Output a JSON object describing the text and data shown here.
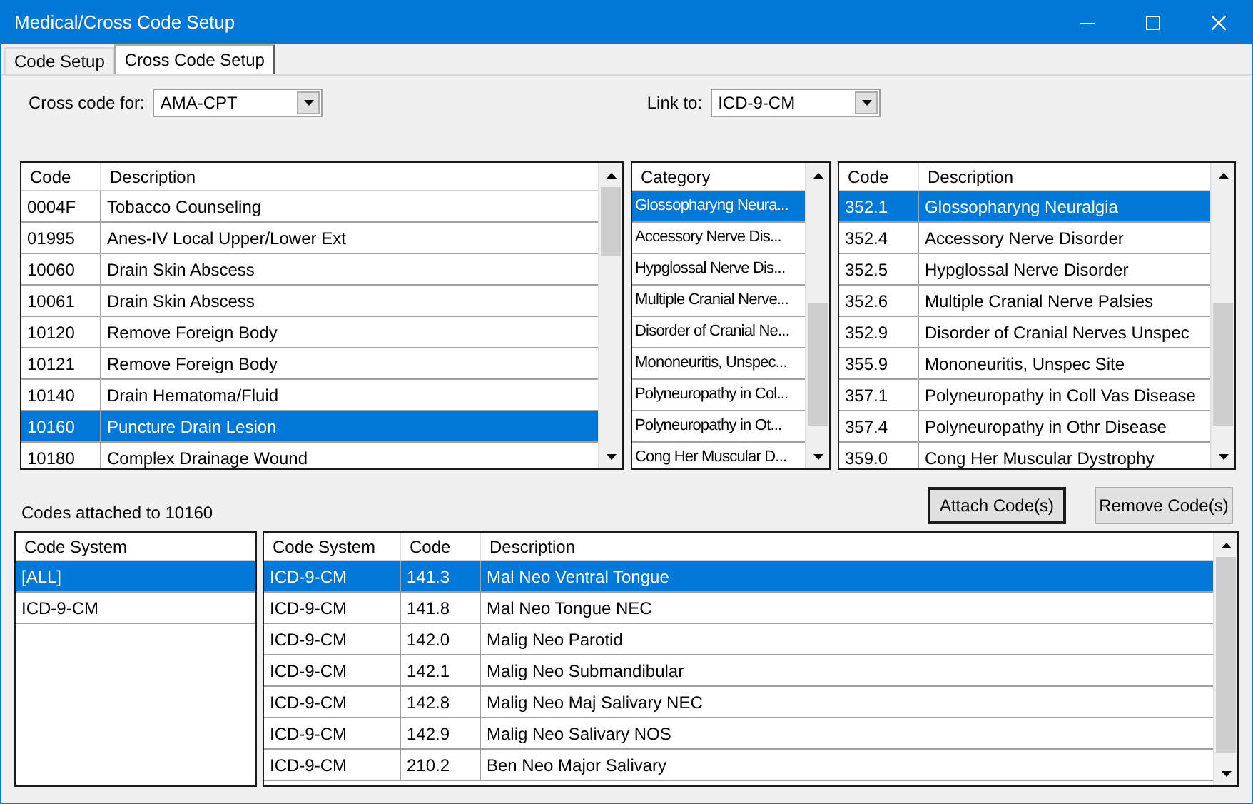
{
  "window": {
    "title": "Medical/Cross Code Setup"
  },
  "tabs": [
    {
      "label": "Code Setup",
      "selected": false
    },
    {
      "label": "Cross Code Setup",
      "selected": true
    }
  ],
  "cross_code_for": {
    "label": "Cross code for:",
    "value": "AMA-CPT"
  },
  "link_to": {
    "label": "Link to:",
    "value": "ICD-9-CM"
  },
  "cpt_table": {
    "columns": [
      "Code",
      "Description"
    ],
    "rows": [
      {
        "cells": [
          "0004F",
          "Tobacco Counseling"
        ],
        "selected": false
      },
      {
        "cells": [
          "01995",
          "Anes-IV Local Upper/Lower Ext"
        ],
        "selected": false
      },
      {
        "cells": [
          "10060",
          "Drain Skin Abscess"
        ],
        "selected": false
      },
      {
        "cells": [
          "10061",
          "Drain Skin Abscess"
        ],
        "selected": false
      },
      {
        "cells": [
          "10120",
          "Remove Foreign Body"
        ],
        "selected": false
      },
      {
        "cells": [
          "10121",
          "Remove Foreign Body"
        ],
        "selected": false
      },
      {
        "cells": [
          "10140",
          "Drain Hematoma/Fluid"
        ],
        "selected": false
      },
      {
        "cells": [
          "10160",
          "Puncture Drain Lesion"
        ],
        "selected": true
      },
      {
        "cells": [
          "10180",
          "Complex Drainage Wound"
        ],
        "selected": false
      }
    ]
  },
  "category_list": {
    "columns": [
      "Category"
    ],
    "rows": [
      {
        "cells": [
          "Glossopharyng Neura..."
        ],
        "selected": true
      },
      {
        "cells": [
          "Accessory Nerve Dis..."
        ],
        "selected": false
      },
      {
        "cells": [
          "Hypglossal Nerve Dis..."
        ],
        "selected": false
      },
      {
        "cells": [
          "Multiple Cranial Nerve..."
        ],
        "selected": false
      },
      {
        "cells": [
          "Disorder of Cranial Ne..."
        ],
        "selected": false
      },
      {
        "cells": [
          "Mononeuritis, Unspec..."
        ],
        "selected": false
      },
      {
        "cells": [
          "Polyneuropathy in Col..."
        ],
        "selected": false
      },
      {
        "cells": [
          "Polyneuropathy in Ot..."
        ],
        "selected": false
      },
      {
        "cells": [
          "Cong Her Muscular D..."
        ],
        "selected": false
      }
    ]
  },
  "icd_table": {
    "columns": [
      "Code",
      "Description"
    ],
    "rows": [
      {
        "cells": [
          "352.1",
          "Glossopharyng Neuralgia"
        ],
        "selected": true
      },
      {
        "cells": [
          "352.4",
          "Accessory Nerve Disorder"
        ],
        "selected": false
      },
      {
        "cells": [
          "352.5",
          "Hypglossal Nerve Disorder"
        ],
        "selected": false
      },
      {
        "cells": [
          "352.6",
          "Multiple Cranial Nerve Palsies"
        ],
        "selected": false
      },
      {
        "cells": [
          "352.9",
          "Disorder of Cranial Nerves Unspec"
        ],
        "selected": false
      },
      {
        "cells": [
          "355.9",
          "Mononeuritis, Unspec Site"
        ],
        "selected": false
      },
      {
        "cells": [
          "357.1",
          "Polyneuropathy in Coll Vas Disease"
        ],
        "selected": false
      },
      {
        "cells": [
          "357.4",
          "Polyneuropathy in Othr Disease"
        ],
        "selected": false
      },
      {
        "cells": [
          "359.0",
          "Cong Her Muscular Dystrophy"
        ],
        "selected": false
      }
    ]
  },
  "attached_label": "Codes attached to 10160",
  "buttons": [
    {
      "label": "Attach Code(s)",
      "default": true
    },
    {
      "label": "Remove Code(s)",
      "default": false
    }
  ],
  "code_system_list": {
    "columns": [
      "Code System"
    ],
    "rows": [
      {
        "cells": [
          "[ALL]"
        ],
        "selected": true
      },
      {
        "cells": [
          "ICD-9-CM"
        ],
        "selected": false
      }
    ]
  },
  "attached_table": {
    "columns": [
      "Code System",
      "Code",
      "Description"
    ],
    "rows": [
      {
        "cells": [
          "ICD-9-CM",
          "141.3",
          "Mal Neo Ventral Tongue"
        ],
        "selected": true
      },
      {
        "cells": [
          "ICD-9-CM",
          "141.8",
          "Mal Neo Tongue NEC"
        ],
        "selected": false
      },
      {
        "cells": [
          "ICD-9-CM",
          "142.0",
          "Malig Neo Parotid"
        ],
        "selected": false
      },
      {
        "cells": [
          "ICD-9-CM",
          "142.1",
          "Malig Neo Submandibular"
        ],
        "selected": false
      },
      {
        "cells": [
          "ICD-9-CM",
          "142.8",
          "Malig Neo Maj Salivary NEC"
        ],
        "selected": false
      },
      {
        "cells": [
          "ICD-9-CM",
          "142.9",
          "Malig Neo Salivary NOS"
        ],
        "selected": false
      },
      {
        "cells": [
          "ICD-9-CM",
          "210.2",
          "Ben Neo Major Salivary"
        ],
        "selected": false
      }
    ]
  }
}
